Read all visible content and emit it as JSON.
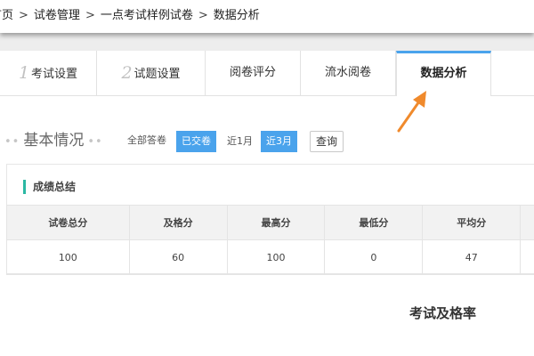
{
  "breadcrumb": {
    "items": [
      "首页",
      "试卷管理",
      "一点考试样例试卷",
      "数据分析"
    ],
    "separator": ">"
  },
  "tabs": [
    {
      "num": "1",
      "label": "考试设置"
    },
    {
      "num": "2",
      "label": "试题设置"
    },
    {
      "num": "",
      "label": "阅卷评分"
    },
    {
      "num": "",
      "label": "流水阅卷"
    },
    {
      "num": "",
      "label": "数据分析",
      "active": true
    }
  ],
  "basic": {
    "dots_left": "••",
    "dots_right": "••",
    "title": "基本情况",
    "filter_label": "全部答卷",
    "chips": [
      {
        "label": "已交卷",
        "selected": true
      },
      {
        "label": "近1月",
        "selected": false
      },
      {
        "label": "近3月",
        "selected": true
      }
    ],
    "query_label": "查询"
  },
  "scores": {
    "title": "成绩总结",
    "headers": [
      "试卷总分",
      "及格分",
      "最高分",
      "最低分",
      "平均分"
    ],
    "values": [
      "100",
      "60",
      "100",
      "0",
      "47"
    ]
  },
  "pass_rate_title": "考试及格率",
  "colors": {
    "accent": "#4aa3ec",
    "card_marker": "#2bb8a3",
    "arrow": "#f08a2c"
  },
  "icons": {
    "annotation_arrow": "arrow-up-right-icon"
  }
}
